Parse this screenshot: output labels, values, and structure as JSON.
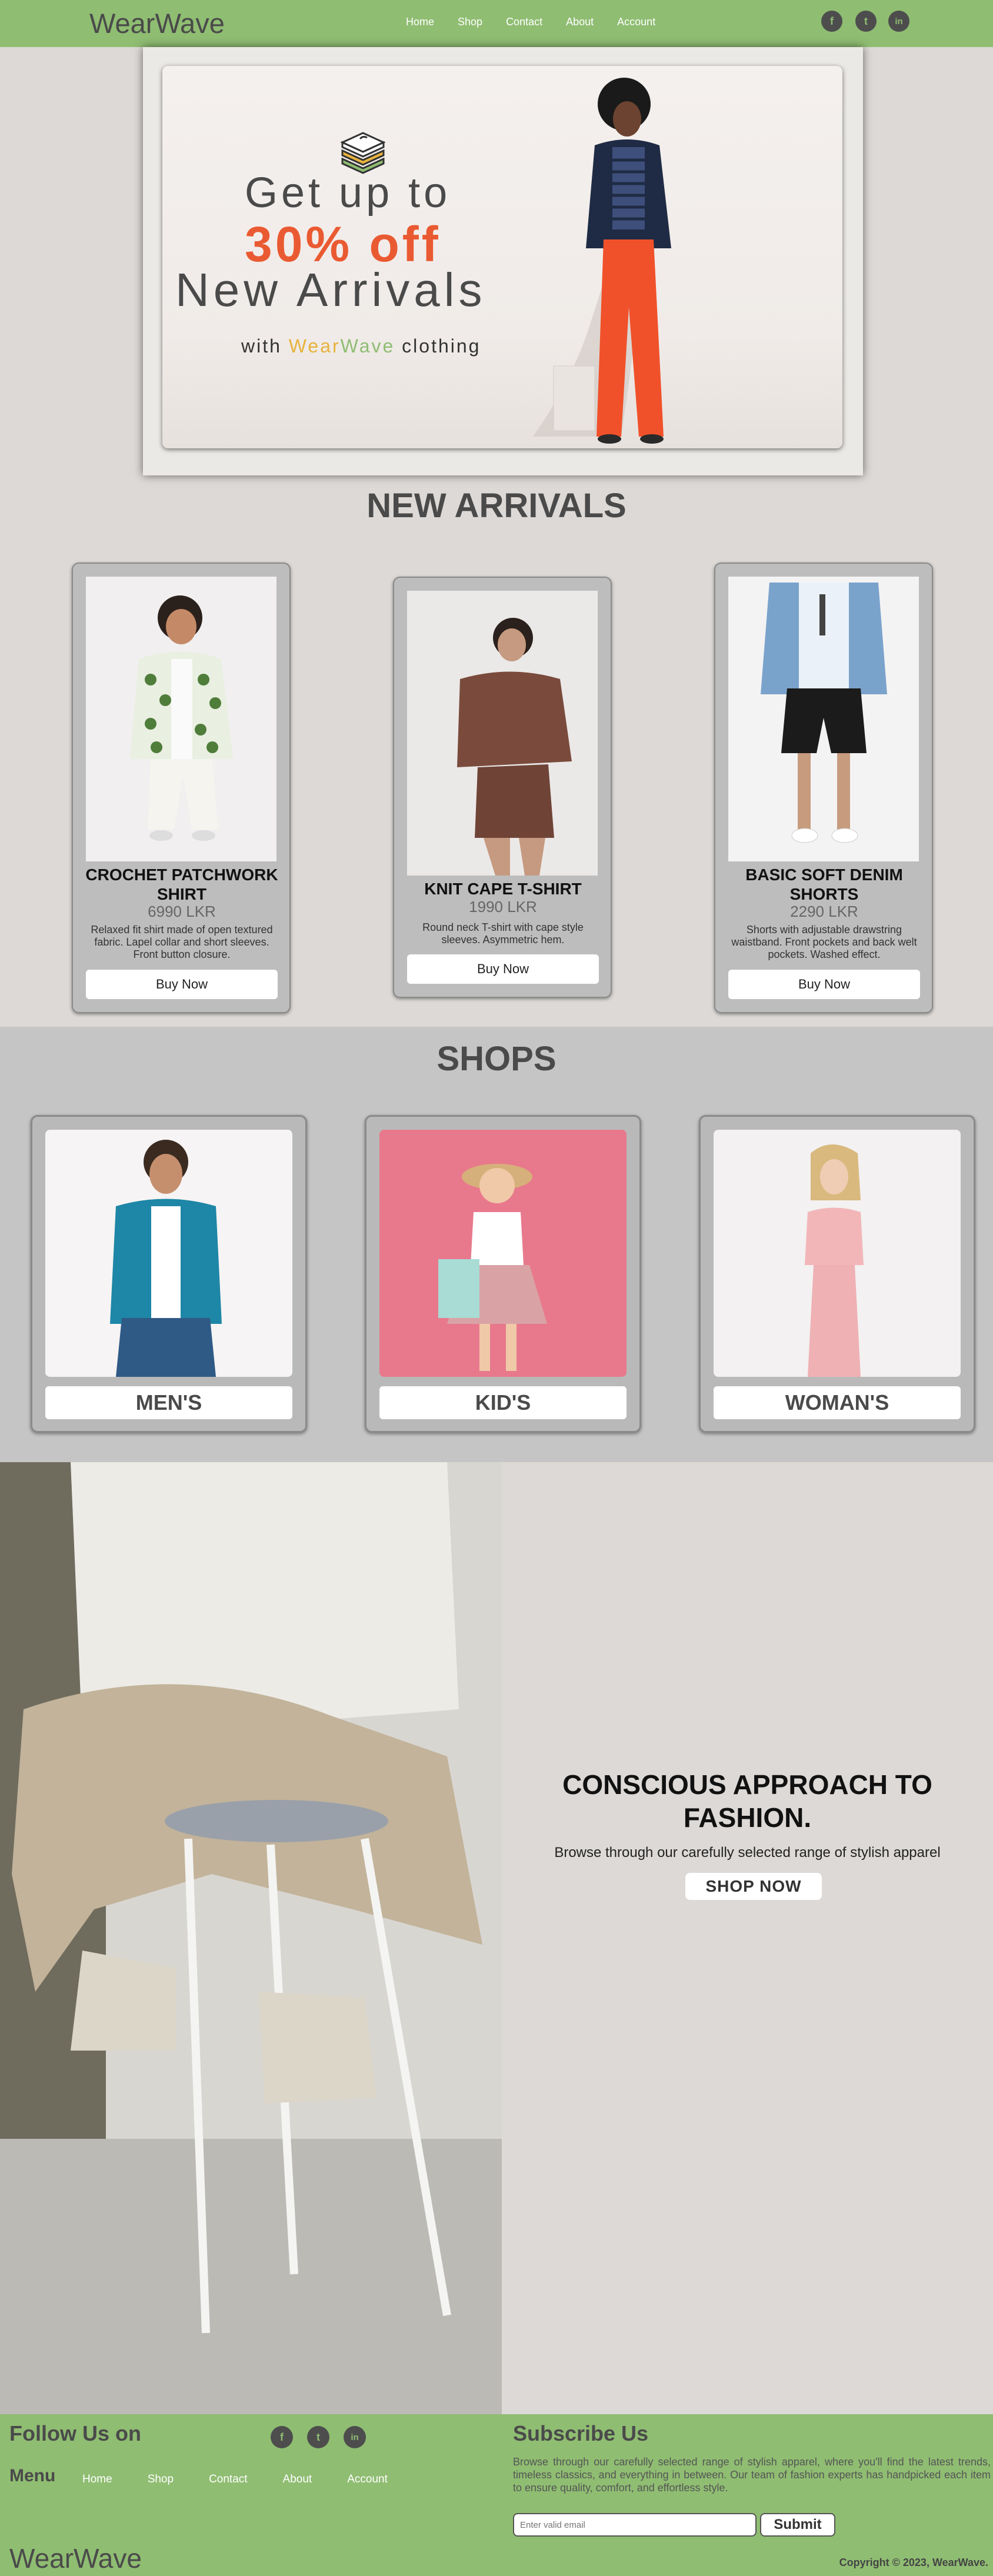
{
  "brand": {
    "logo": "WearWave"
  },
  "nav": {
    "links": [
      "Home",
      "Shop",
      "Contact",
      "About",
      "Account"
    ],
    "social": [
      "facebook-icon",
      "twitter-icon",
      "linkedin-icon"
    ],
    "social_glyphs": [
      "f",
      "t",
      "in"
    ]
  },
  "hero": {
    "line1": "Get up to",
    "line2": "30% off",
    "line3": "New Arrivals",
    "tagline_prefix": "with ",
    "tagline_brand_a": "Wear",
    "tagline_brand_b": "Wave",
    "tagline_suffix": " clothing"
  },
  "new_arrivals": {
    "title": "NEW ARRIVALS",
    "products": [
      {
        "name": "CROCHET PATCHWORK SHIRT",
        "price": "6990 LKR",
        "desc": "Relaxed fit shirt made of open textured fabric. Lapel collar and short sleeves. Front button closure.",
        "button": "Buy Now"
      },
      {
        "name": "KNIT CAPE T-SHIRT",
        "price": "1990 LKR",
        "desc": "Round neck T-shirt with cape style sleeves. Asymmetric hem.",
        "button": "Buy Now"
      },
      {
        "name": "BASIC SOFT DENIM SHORTS",
        "price": "2290 LKR",
        "desc": "Shorts with adjustable drawstring waistband. Front pockets and back welt pockets. Washed effect.",
        "button": "Buy Now"
      }
    ]
  },
  "shops": {
    "title": "SHOPS",
    "categories": [
      "MEN'S",
      "KID'S",
      "WOMAN'S"
    ]
  },
  "promo": {
    "title": "CONSCIOUS APPROACH TO FASHION.",
    "subtitle": "Browse through our carefully selected range of stylish apparel",
    "button": "SHOP NOW"
  },
  "footer": {
    "follow": "Follow Us on",
    "menu": "Menu",
    "links": [
      "Home",
      "Shop",
      "Contact",
      "About",
      "Account"
    ],
    "logo": "WearWave",
    "subscribe_title": "Subscribe Us",
    "subscribe_text": "Browse through our carefully selected range of stylish apparel, where you'll find the latest trends, timeless classics, and everything in between. Our team of fashion experts has handpicked each item to ensure quality, comfort, and effortless style.",
    "email_placeholder": "Enter valid email",
    "submit": "Submit",
    "copyright": "Copyright © 2023, WearWave."
  },
  "colors": {
    "nav_bg": "#8fbd72",
    "accent_orange": "#ea5a32",
    "text_dark": "#4a4a4a",
    "page_bg": "#dcd9d6"
  }
}
